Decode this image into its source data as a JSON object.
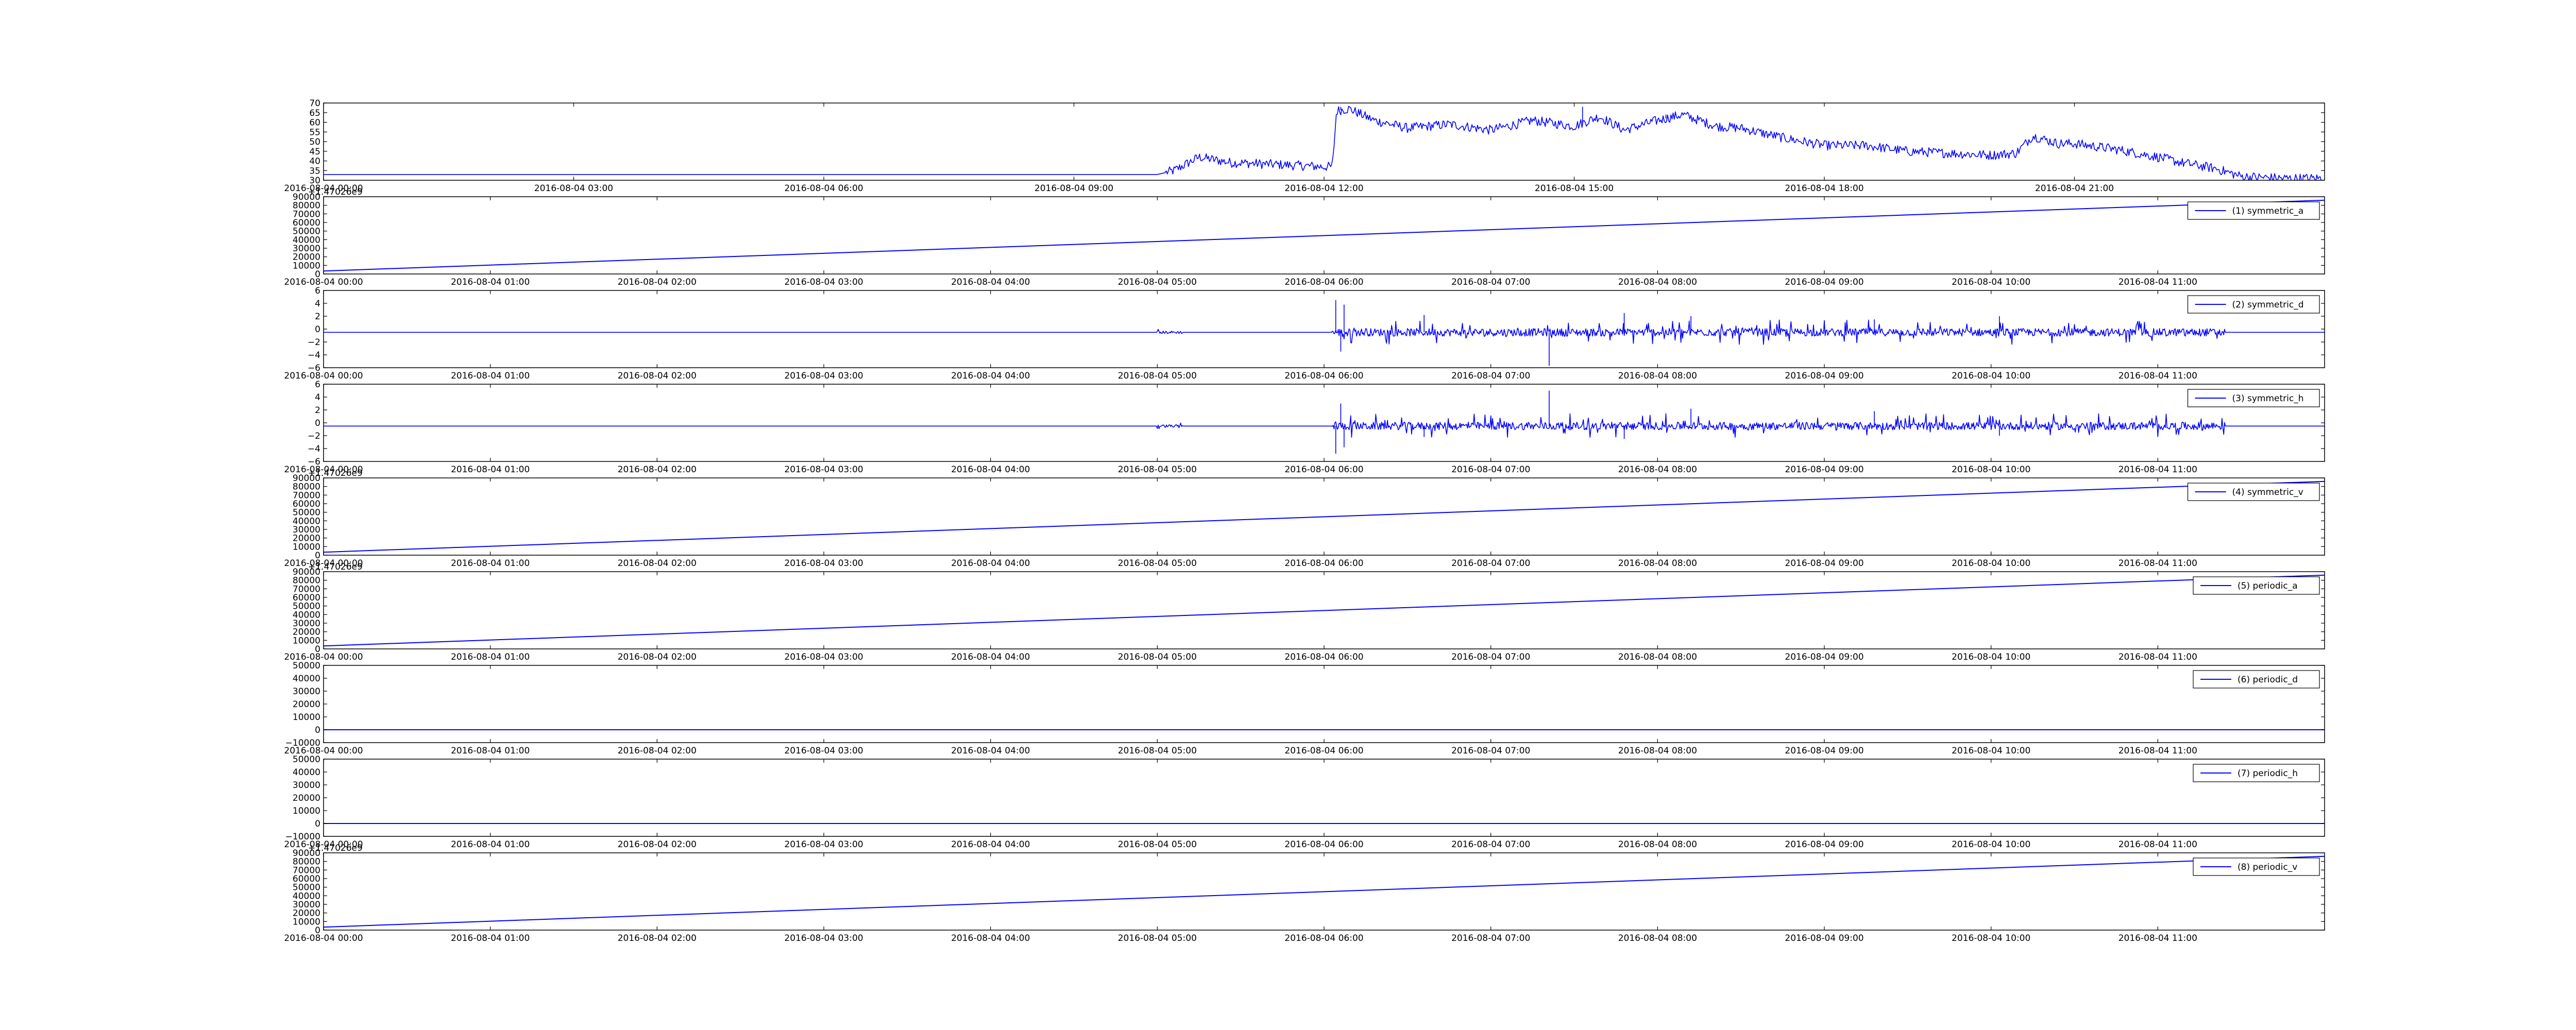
{
  "figure": {
    "line_color": "#0000ff",
    "axis_color": "#000000",
    "background": "#ffffff"
  },
  "chart_data": [
    {
      "type": "line",
      "title": "",
      "xlabel": "",
      "ylabel": "",
      "legend": null,
      "x_ticks": [
        "2016-08-04 00:00",
        "2016-08-04 03:00",
        "2016-08-04 06:00",
        "2016-08-04 09:00",
        "2016-08-04 12:00",
        "2016-08-04 15:00",
        "2016-08-04 18:00",
        "2016-08-04 21:00"
      ],
      "xlim": [
        0,
        24
      ],
      "ylim": [
        30,
        70
      ],
      "y_ticks": [
        "30",
        "35",
        "40",
        "45",
        "50",
        "55",
        "60",
        "65",
        "70"
      ],
      "y_offset": "",
      "series": [
        {
          "name": "",
          "kind": "noisy",
          "points": [
            [
              0,
              33
            ],
            [
              10,
              33
            ],
            [
              10.2,
              35
            ],
            [
              10.5,
              42
            ],
            [
              10.9,
              39
            ],
            [
              11,
              39
            ],
            [
              11.5,
              38
            ],
            [
              12,
              37
            ],
            [
              12.1,
              37
            ],
            [
              12.15,
              66
            ],
            [
              12.3,
              67
            ],
            [
              12.6,
              61
            ],
            [
              13,
              57
            ],
            [
              13.5,
              59
            ],
            [
              14,
              56
            ],
            [
              14.5,
              61
            ],
            [
              15,
              58
            ],
            [
              15.3,
              63
            ],
            [
              15.6,
              56
            ],
            [
              16,
              61
            ],
            [
              16.3,
              64
            ],
            [
              16.7,
              58
            ],
            [
              17,
              57
            ],
            [
              17.5,
              52
            ],
            [
              18,
              48
            ],
            [
              18.5,
              48
            ],
            [
              19,
              45
            ],
            [
              19.5,
              44
            ],
            [
              20,
              43
            ],
            [
              20.3,
              44
            ],
            [
              20.5,
              53
            ],
            [
              20.8,
              49
            ],
            [
              21,
              49
            ],
            [
              21.5,
              46
            ],
            [
              22,
              42
            ],
            [
              22.3,
              39
            ],
            [
              22.7,
              36
            ],
            [
              23,
              32
            ],
            [
              23.5,
              31
            ],
            [
              24,
              31
            ]
          ],
          "noise": 2.5,
          "spikes": [
            [
              12.2,
              68
            ],
            [
              15.1,
              68
            ],
            [
              16.1,
              64
            ]
          ]
        }
      ]
    },
    {
      "type": "line",
      "title": "",
      "xlabel": "",
      "ylabel": "",
      "legend": "(1) symmetric_a",
      "x_ticks": [
        "2016-08-04 00:00",
        "2016-08-04 01:00",
        "2016-08-04 02:00",
        "2016-08-04 03:00",
        "2016-08-04 04:00",
        "2016-08-04 05:00",
        "2016-08-04 06:00",
        "2016-08-04 07:00",
        "2016-08-04 08:00",
        "2016-08-04 09:00",
        "2016-08-04 10:00",
        "2016-08-04 11:00"
      ],
      "xlim": [
        0,
        12
      ],
      "ylim": [
        0,
        90000
      ],
      "y_ticks": [
        "0",
        "10000",
        "20000",
        "30000",
        "40000",
        "50000",
        "60000",
        "70000",
        "80000",
        "90000"
      ],
      "y_offset": "+1.47026e9",
      "series": [
        {
          "name": "(1) symmetric_a",
          "kind": "line",
          "points": [
            [
              0,
              3500
            ],
            [
              12,
              86000
            ]
          ]
        }
      ]
    },
    {
      "type": "line",
      "title": "",
      "xlabel": "",
      "ylabel": "",
      "legend": "(2) symmetric_d",
      "x_ticks": [
        "2016-08-04 00:00",
        "2016-08-04 01:00",
        "2016-08-04 02:00",
        "2016-08-04 03:00",
        "2016-08-04 04:00",
        "2016-08-04 05:00",
        "2016-08-04 06:00",
        "2016-08-04 07:00",
        "2016-08-04 08:00",
        "2016-08-04 09:00",
        "2016-08-04 10:00",
        "2016-08-04 11:00"
      ],
      "xlim": [
        0,
        12
      ],
      "ylim": [
        -6,
        6
      ],
      "y_ticks": [
        "−6",
        "−4",
        "−2",
        "0",
        "2",
        "4",
        "6"
      ],
      "y_offset": "",
      "series": [
        {
          "name": "(2) symmetric_d",
          "kind": "spiky",
          "base": -0.5,
          "active_ranges": [
            [
              5.0,
              5.15,
              0.4
            ],
            [
              6.05,
              11.4,
              1.2
            ]
          ],
          "spikes": [
            [
              6.07,
              4.5
            ],
            [
              6.12,
              3.8
            ],
            [
              6.1,
              -3.5
            ],
            [
              7.35,
              -5.7
            ],
            [
              6.6,
              2.2
            ],
            [
              7.8,
              2.5
            ],
            [
              8.2,
              2.0
            ],
            [
              9.3,
              1.5
            ],
            [
              10.05,
              2.0
            ]
          ]
        }
      ]
    },
    {
      "type": "line",
      "title": "",
      "xlabel": "",
      "ylabel": "",
      "legend": "(3) symmetric_h",
      "x_ticks": [
        "2016-08-04 00:00",
        "2016-08-04 01:00",
        "2016-08-04 02:00",
        "2016-08-04 03:00",
        "2016-08-04 04:00",
        "2016-08-04 05:00",
        "2016-08-04 06:00",
        "2016-08-04 07:00",
        "2016-08-04 08:00",
        "2016-08-04 09:00",
        "2016-08-04 10:00",
        "2016-08-04 11:00"
      ],
      "xlim": [
        0,
        12
      ],
      "ylim": [
        -6,
        6
      ],
      "y_ticks": [
        "−6",
        "−4",
        "−2",
        "0",
        "2",
        "4",
        "6"
      ],
      "y_offset": "",
      "series": [
        {
          "name": "(3) symmetric_h",
          "kind": "spiky",
          "base": -0.5,
          "active_ranges": [
            [
              5.0,
              5.15,
              0.4
            ],
            [
              6.05,
              11.4,
              1.2
            ]
          ],
          "spikes": [
            [
              6.07,
              -4.8
            ],
            [
              6.12,
              -3.8
            ],
            [
              6.1,
              3.0
            ],
            [
              7.35,
              5.0
            ],
            [
              6.6,
              -2.2
            ],
            [
              7.8,
              -2.5
            ],
            [
              8.2,
              2.2
            ],
            [
              9.3,
              1.8
            ],
            [
              10.05,
              -2.0
            ]
          ]
        }
      ]
    },
    {
      "type": "line",
      "title": "",
      "xlabel": "",
      "ylabel": "",
      "legend": "(4) symmetric_v",
      "x_ticks": [
        "2016-08-04 00:00",
        "2016-08-04 01:00",
        "2016-08-04 02:00",
        "2016-08-04 03:00",
        "2016-08-04 04:00",
        "2016-08-04 05:00",
        "2016-08-04 06:00",
        "2016-08-04 07:00",
        "2016-08-04 08:00",
        "2016-08-04 09:00",
        "2016-08-04 10:00",
        "2016-08-04 11:00"
      ],
      "xlim": [
        0,
        12
      ],
      "ylim": [
        0,
        90000
      ],
      "y_ticks": [
        "0",
        "10000",
        "20000",
        "30000",
        "40000",
        "50000",
        "60000",
        "70000",
        "80000",
        "90000"
      ],
      "y_offset": "+1.47026e9",
      "series": [
        {
          "name": "(4) symmetric_v",
          "kind": "line",
          "points": [
            [
              0,
              3500
            ],
            [
              12,
              86000
            ]
          ]
        }
      ]
    },
    {
      "type": "line",
      "title": "",
      "xlabel": "",
      "ylabel": "",
      "legend": "(5) periodic_a",
      "x_ticks": [
        "2016-08-04 00:00",
        "2016-08-04 01:00",
        "2016-08-04 02:00",
        "2016-08-04 03:00",
        "2016-08-04 04:00",
        "2016-08-04 05:00",
        "2016-08-04 06:00",
        "2016-08-04 07:00",
        "2016-08-04 08:00",
        "2016-08-04 09:00",
        "2016-08-04 10:00",
        "2016-08-04 11:00"
      ],
      "xlim": [
        0,
        12
      ],
      "ylim": [
        0,
        90000
      ],
      "y_ticks": [
        "0",
        "10000",
        "20000",
        "30000",
        "40000",
        "50000",
        "60000",
        "70000",
        "80000",
        "90000"
      ],
      "y_offset": "+1.47026e9",
      "series": [
        {
          "name": "(5) periodic_a",
          "kind": "line",
          "points": [
            [
              0,
              3500
            ],
            [
              12,
              86000
            ]
          ]
        }
      ]
    },
    {
      "type": "line",
      "title": "",
      "xlabel": "",
      "ylabel": "",
      "legend": "(6) periodic_d",
      "x_ticks": [
        "2016-08-04 00:00",
        "2016-08-04 01:00",
        "2016-08-04 02:00",
        "2016-08-04 03:00",
        "2016-08-04 04:00",
        "2016-08-04 05:00",
        "2016-08-04 06:00",
        "2016-08-04 07:00",
        "2016-08-04 08:00",
        "2016-08-04 09:00",
        "2016-08-04 10:00",
        "2016-08-04 11:00"
      ],
      "xlim": [
        0,
        12
      ],
      "ylim": [
        -10000,
        50000
      ],
      "y_ticks": [
        "−10000",
        "0",
        "10000",
        "20000",
        "30000",
        "40000",
        "50000"
      ],
      "y_offset": "",
      "series": [
        {
          "name": "(6) periodic_d",
          "kind": "line",
          "points": [
            [
              0,
              0
            ],
            [
              12,
              0
            ]
          ]
        }
      ]
    },
    {
      "type": "line",
      "title": "",
      "xlabel": "",
      "ylabel": "",
      "legend": "(7) periodic_h",
      "x_ticks": [
        "2016-08-04 00:00",
        "2016-08-04 01:00",
        "2016-08-04 02:00",
        "2016-08-04 03:00",
        "2016-08-04 04:00",
        "2016-08-04 05:00",
        "2016-08-04 06:00",
        "2016-08-04 07:00",
        "2016-08-04 08:00",
        "2016-08-04 09:00",
        "2016-08-04 10:00",
        "2016-08-04 11:00"
      ],
      "xlim": [
        0,
        12
      ],
      "ylim": [
        -10000,
        50000
      ],
      "y_ticks": [
        "−10000",
        "0",
        "10000",
        "20000",
        "30000",
        "40000",
        "50000"
      ],
      "y_offset": "",
      "series": [
        {
          "name": "(7) periodic_h",
          "kind": "line",
          "points": [
            [
              0,
              0
            ],
            [
              12,
              0
            ]
          ]
        }
      ]
    },
    {
      "type": "line",
      "title": "",
      "xlabel": "",
      "ylabel": "",
      "legend": "(8) periodic_v",
      "x_ticks": [
        "2016-08-04 00:00",
        "2016-08-04 01:00",
        "2016-08-04 02:00",
        "2016-08-04 03:00",
        "2016-08-04 04:00",
        "2016-08-04 05:00",
        "2016-08-04 06:00",
        "2016-08-04 07:00",
        "2016-08-04 08:00",
        "2016-08-04 09:00",
        "2016-08-04 10:00",
        "2016-08-04 11:00"
      ],
      "xlim": [
        0,
        12
      ],
      "ylim": [
        0,
        90000
      ],
      "y_ticks": [
        "0",
        "10000",
        "20000",
        "30000",
        "40000",
        "50000",
        "60000",
        "70000",
        "80000",
        "90000"
      ],
      "y_offset": "+1.47026e9",
      "series": [
        {
          "name": "(8) periodic_v",
          "kind": "line",
          "points": [
            [
              0,
              3500
            ],
            [
              12,
              86000
            ]
          ]
        }
      ]
    }
  ]
}
